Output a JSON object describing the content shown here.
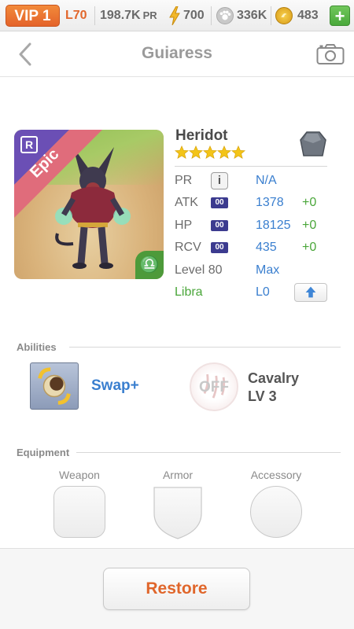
{
  "topbar": {
    "vip": "VIP 1",
    "level": "L70",
    "pr_value": "198.7K",
    "pr_unit": "PR",
    "energy": "700",
    "paw": "336K",
    "coins": "483",
    "plus": "+"
  },
  "header": {
    "title": "Guiaress"
  },
  "hero": {
    "name": "Heridot",
    "rarity": "Epic",
    "rarity_badge": "R",
    "stars": 5,
    "zodiac_glyph": "♎",
    "stats": [
      {
        "label": "PR",
        "value": "N/A",
        "bonus": ""
      },
      {
        "label": "ATK",
        "tag": "00",
        "value": "1378",
        "bonus": "+0"
      },
      {
        "label": "HP",
        "tag": "00",
        "value": "18125",
        "bonus": "+0"
      },
      {
        "label": "RCV",
        "tag": "00",
        "value": "435",
        "bonus": "+0"
      },
      {
        "label": "Level 80",
        "value": "Max",
        "bonus": ""
      },
      {
        "label": "Libra",
        "value": "L0",
        "bonus": ""
      }
    ],
    "info_glyph": "i"
  },
  "abilities": {
    "section_title": "Abilities",
    "active_name": "Swap+",
    "passive_state": "OFF",
    "passive_name_line1": "Cavalry",
    "passive_name_line2": "LV 3"
  },
  "equipment": {
    "section_title": "Equipment",
    "slots": [
      "Weapon",
      "Armor",
      "Accessory"
    ]
  },
  "actions": {
    "restore": "Restore"
  },
  "colors": {
    "accent_orange": "#e0662b",
    "value_blue": "#3a7fcf",
    "bonus_green": "#4aa63a",
    "epic_pink": "#e06c7b",
    "epic_purple": "#6b4fb5"
  }
}
